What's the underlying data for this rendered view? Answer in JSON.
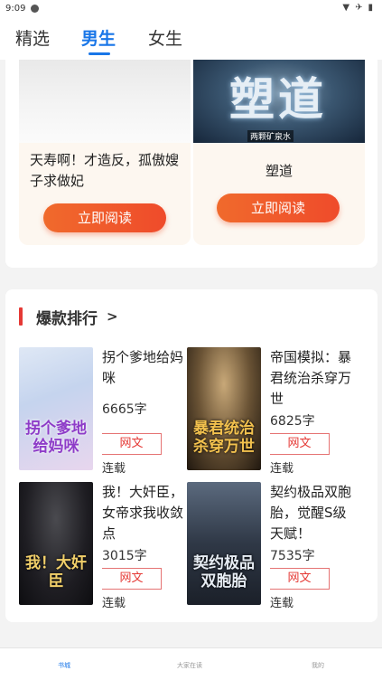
{
  "status_bar": {
    "time": "9:09"
  },
  "tabs": [
    {
      "label": "精选"
    },
    {
      "label": "男生",
      "active": true
    },
    {
      "label": "女生"
    }
  ],
  "featured": [
    {
      "title": "天寿啊！才造反，孤傲嫂子求做妃",
      "button": "立即阅读"
    },
    {
      "cover_title": "塑道",
      "cover_author": "两颗矿泉水",
      "title": "塑道",
      "button": "立即阅读"
    }
  ],
  "ranking": {
    "title": "爆款排行",
    "books": [
      {
        "title": "拐个爹地给妈咪",
        "cover_title": "拐个爹地给妈咪",
        "words": "6665字",
        "tag": "网文",
        "status": "连载"
      },
      {
        "title": "帝国模拟：暴君统治杀穿万世",
        "cover_title": "暴君统治杀穿万世",
        "words": "6825字",
        "tag": "网文",
        "status": "连载"
      },
      {
        "title": "我！大奸臣，女帝求我收敛点",
        "cover_title": "我！大奸臣",
        "words": "3015字",
        "tag": "网文",
        "status": "连载"
      },
      {
        "title": "契约极品双胞胎，觉醒S级天赋！",
        "cover_title": "契约极品双胞胎",
        "words": "7535字",
        "tag": "网文",
        "status": "连载"
      }
    ]
  },
  "bottom_nav": [
    {
      "label": "书城",
      "active": true
    },
    {
      "label": "大家在读"
    },
    {
      "label": "我的"
    }
  ],
  "colors": {
    "accent": "#1976e8",
    "button": "#ef5a2c",
    "rank_bar": "#e53935"
  }
}
